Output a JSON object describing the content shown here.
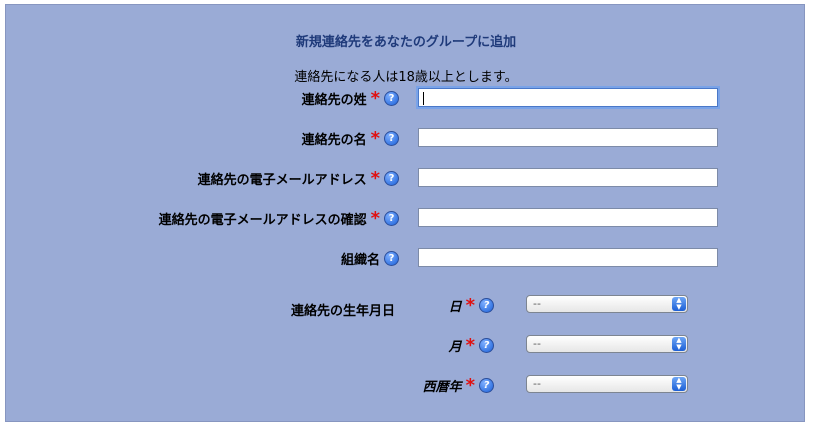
{
  "form": {
    "title": "新規連絡先をあなたのグループに追加",
    "notice": "連絡先になる人は18歳以上とします。",
    "required_mark": "*",
    "help_glyph": "?",
    "fields": [
      {
        "label": "連絡先の姓",
        "value": "",
        "required": true
      },
      {
        "label": "連絡先の名",
        "value": "",
        "required": true
      },
      {
        "label": "連絡先の電子メールアドレス",
        "value": "",
        "required": true
      },
      {
        "label": "連絡先の電子メールアドレスの確認",
        "value": "",
        "required": true
      },
      {
        "label": "組織名",
        "value": "",
        "required": false
      }
    ],
    "dob": {
      "label": "連絡先の生年月日",
      "parts": [
        {
          "label": "日",
          "selected": "--"
        },
        {
          "label": "月",
          "selected": "--"
        },
        {
          "label": "西暦年",
          "selected": "--"
        }
      ]
    }
  },
  "colors": {
    "panel_bg": "#9aabd6",
    "title": "#1f3a7a",
    "required": "#e01010",
    "help_icon": "#1a5fd8"
  }
}
